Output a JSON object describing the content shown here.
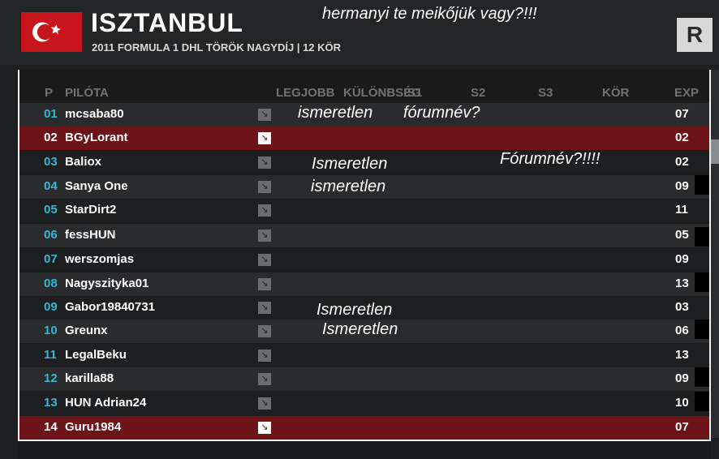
{
  "header": {
    "track_name": "ISZTANBUL",
    "subtitle": "2011 FORMULA 1 DHL TÖRÖK NAGYDÍJ | 12 KÖR",
    "r_button": "R",
    "comment": "hermanyi te meikőjük vagy?!!!"
  },
  "columns": [
    "P",
    "PILÓTA",
    "LEGJOBB",
    "KÜLÖNBSÉG",
    "S1",
    "S2",
    "S3",
    "KÖR",
    "EXP"
  ],
  "rows": [
    {
      "pos": "01",
      "pilot": "mcsaba80",
      "exp": "07",
      "style": "light"
    },
    {
      "pos": "02",
      "pilot": "BGyLorant",
      "exp": "02",
      "style": "highlight"
    },
    {
      "pos": "03",
      "pilot": "Baliox",
      "exp": "02",
      "style": "dark"
    },
    {
      "pos": "04",
      "pilot": "Sanya One",
      "exp": "09",
      "style": "light"
    },
    {
      "pos": "05",
      "pilot": "StarDirt2",
      "exp": "11",
      "style": "dark"
    },
    {
      "pos": "06",
      "pilot": "fessHUN",
      "exp": "05",
      "style": "light"
    },
    {
      "pos": "07",
      "pilot": "werszomjas",
      "exp": "09",
      "style": "dark"
    },
    {
      "pos": "08",
      "pilot": "Nagyszityka01",
      "exp": "13",
      "style": "light"
    },
    {
      "pos": "09",
      "pilot": "Gabor19840731",
      "exp": "03",
      "style": "dark"
    },
    {
      "pos": "10",
      "pilot": "Greunx",
      "exp": "06",
      "style": "light"
    },
    {
      "pos": "11",
      "pilot": "LegalBeku",
      "exp": "13",
      "style": "dark"
    },
    {
      "pos": "12",
      "pilot": "karilla88",
      "exp": "09",
      "style": "light"
    },
    {
      "pos": "13",
      "pilot": "HUN Adrian24",
      "exp": "10",
      "style": "dark"
    },
    {
      "pos": "14",
      "pilot": "Guru1984",
      "exp": "07",
      "style": "highlight"
    }
  ],
  "comments": {
    "c1": "ismeretlen",
    "c2": "fórumnév?",
    "c3": "Ismeretlen",
    "c4": "Fórumnév?!!!!",
    "c5": "ismeretlen",
    "c6": "Ismeretlen",
    "c7": "Ismeretlen"
  },
  "colors": {
    "accent_cyan": "#35b6d6",
    "highlight_red": "#6b1316",
    "flag_red": "#c8141c"
  }
}
